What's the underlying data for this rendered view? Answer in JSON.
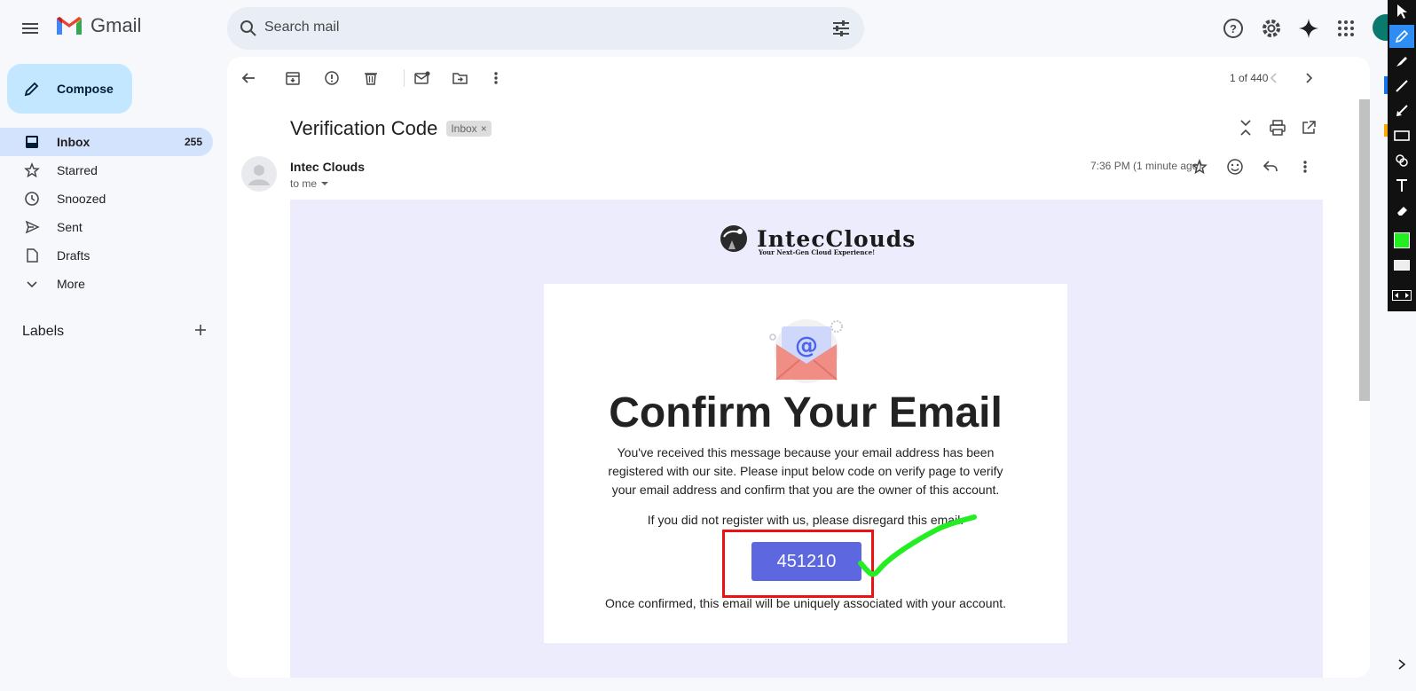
{
  "app": {
    "name": "Gmail"
  },
  "search": {
    "placeholder": "Search mail"
  },
  "sidebar": {
    "compose_label": "Compose",
    "items": [
      {
        "label": "Inbox",
        "count": "255",
        "icon": "inbox-icon",
        "active": true
      },
      {
        "label": "Starred",
        "count": "",
        "icon": "star-icon"
      },
      {
        "label": "Snoozed",
        "count": "",
        "icon": "clock-icon"
      },
      {
        "label": "Sent",
        "count": "",
        "icon": "send-icon"
      },
      {
        "label": "Drafts",
        "count": "",
        "icon": "draft-icon"
      },
      {
        "label": "More",
        "count": "",
        "icon": "chevron-down-icon"
      }
    ],
    "labels_heading": "Labels"
  },
  "toolbar": {
    "pager": "1 of 440"
  },
  "message": {
    "subject": "Verification Code",
    "label_chip": "Inbox",
    "sender": "Intec Clouds",
    "to": "to me",
    "time": "7:36 PM (1 minute ago)"
  },
  "email": {
    "brand_name": "IntecClouds",
    "brand_tagline": "Your Next-Gen Cloud Experience!",
    "title": "Confirm Your Email",
    "body": "You've received this message because your email address has been registered with our site. Please input below code on verify page to verify your email address and confirm that you are the owner of this account.",
    "note": "If you did not register with us, please disregard this email.",
    "code": "451210",
    "footer": "Once confirmed, this email will be uniquely associated with your account."
  },
  "colors": {
    "code_button": "#5d68e0",
    "annotation_rect": "#ee1111",
    "annotation_check": "#22ee22",
    "compose_bg": "#c2e7ff",
    "active_nav": "#d3e3fd"
  },
  "palette_tools": [
    "cursor-icon",
    "pencil-icon",
    "highlighter-icon",
    "line-icon",
    "arrow-icon",
    "rectangle-icon",
    "stamp-icon",
    "text-icon",
    "eraser-icon",
    "color-swatch",
    "fill-swatch",
    "expand-icon"
  ]
}
